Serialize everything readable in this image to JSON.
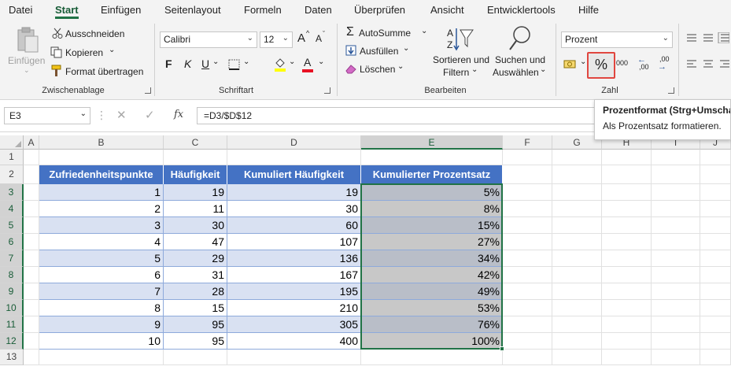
{
  "menu": {
    "tabs": [
      "Datei",
      "Start",
      "Einfügen",
      "Seitenlayout",
      "Formeln",
      "Daten",
      "Überprüfen",
      "Ansicht",
      "Entwicklertools",
      "Hilfe"
    ],
    "active": "Start"
  },
  "ribbon": {
    "clipboard": {
      "paste_label": "Einfügen",
      "cut_label": "Ausschneiden",
      "copy_label": "Kopieren",
      "format_painter_label": "Format übertragen",
      "group_label": "Zwischenablage"
    },
    "font": {
      "font_name": "Calibri",
      "font_size": "12",
      "grow_label": "A",
      "shrink_label": "A",
      "bold_label": "F",
      "italic_label": "K",
      "underline_label": "U",
      "font_color_label": "A",
      "group_label": "Schriftart"
    },
    "editing": {
      "autosum_label": "AutoSumme",
      "fill_label": "Ausfüllen",
      "clear_label": "Löschen",
      "sort_label_1": "Sortieren und",
      "sort_label_2": "Filtern",
      "find_label_1": "Suchen und",
      "find_label_2": "Auswählen",
      "group_label": "Bearbeiten"
    },
    "number": {
      "format_value": "Prozent",
      "percent_label": "%",
      "thousands_label": "000",
      "inc_decimal_label": ",00",
      "dec_decimal_label": ",00",
      "group_label": "Zahl"
    }
  },
  "tooltip": {
    "title": "Prozentformat (Strg+Umscha",
    "description": "Als Prozentsatz formatieren."
  },
  "formula_bar": {
    "name_box": "E3",
    "fx_label": "fx",
    "formula": "=D3/$D$12"
  },
  "sheet": {
    "columns": [
      "A",
      "B",
      "C",
      "D",
      "E",
      "F",
      "G",
      "H",
      "I",
      "J"
    ],
    "rows": [
      "1",
      "2",
      "3",
      "4",
      "5",
      "6",
      "7",
      "8",
      "9",
      "10",
      "11",
      "12",
      "13"
    ],
    "headers": [
      "Zufriedenheitspunkte",
      "Häufigkeit",
      "Kumuliert Häufigkeit",
      "Kumulierter Prozentsatz"
    ],
    "data": [
      [
        "1",
        "19",
        "19",
        "5%"
      ],
      [
        "2",
        "11",
        "30",
        "8%"
      ],
      [
        "3",
        "30",
        "60",
        "15%"
      ],
      [
        "4",
        "47",
        "107",
        "27%"
      ],
      [
        "5",
        "29",
        "136",
        "34%"
      ],
      [
        "6",
        "31",
        "167",
        "42%"
      ],
      [
        "7",
        "28",
        "195",
        "49%"
      ],
      [
        "8",
        "15",
        "210",
        "53%"
      ],
      [
        "9",
        "95",
        "305",
        "76%"
      ],
      [
        "10",
        "95",
        "400",
        "100%"
      ]
    ]
  }
}
